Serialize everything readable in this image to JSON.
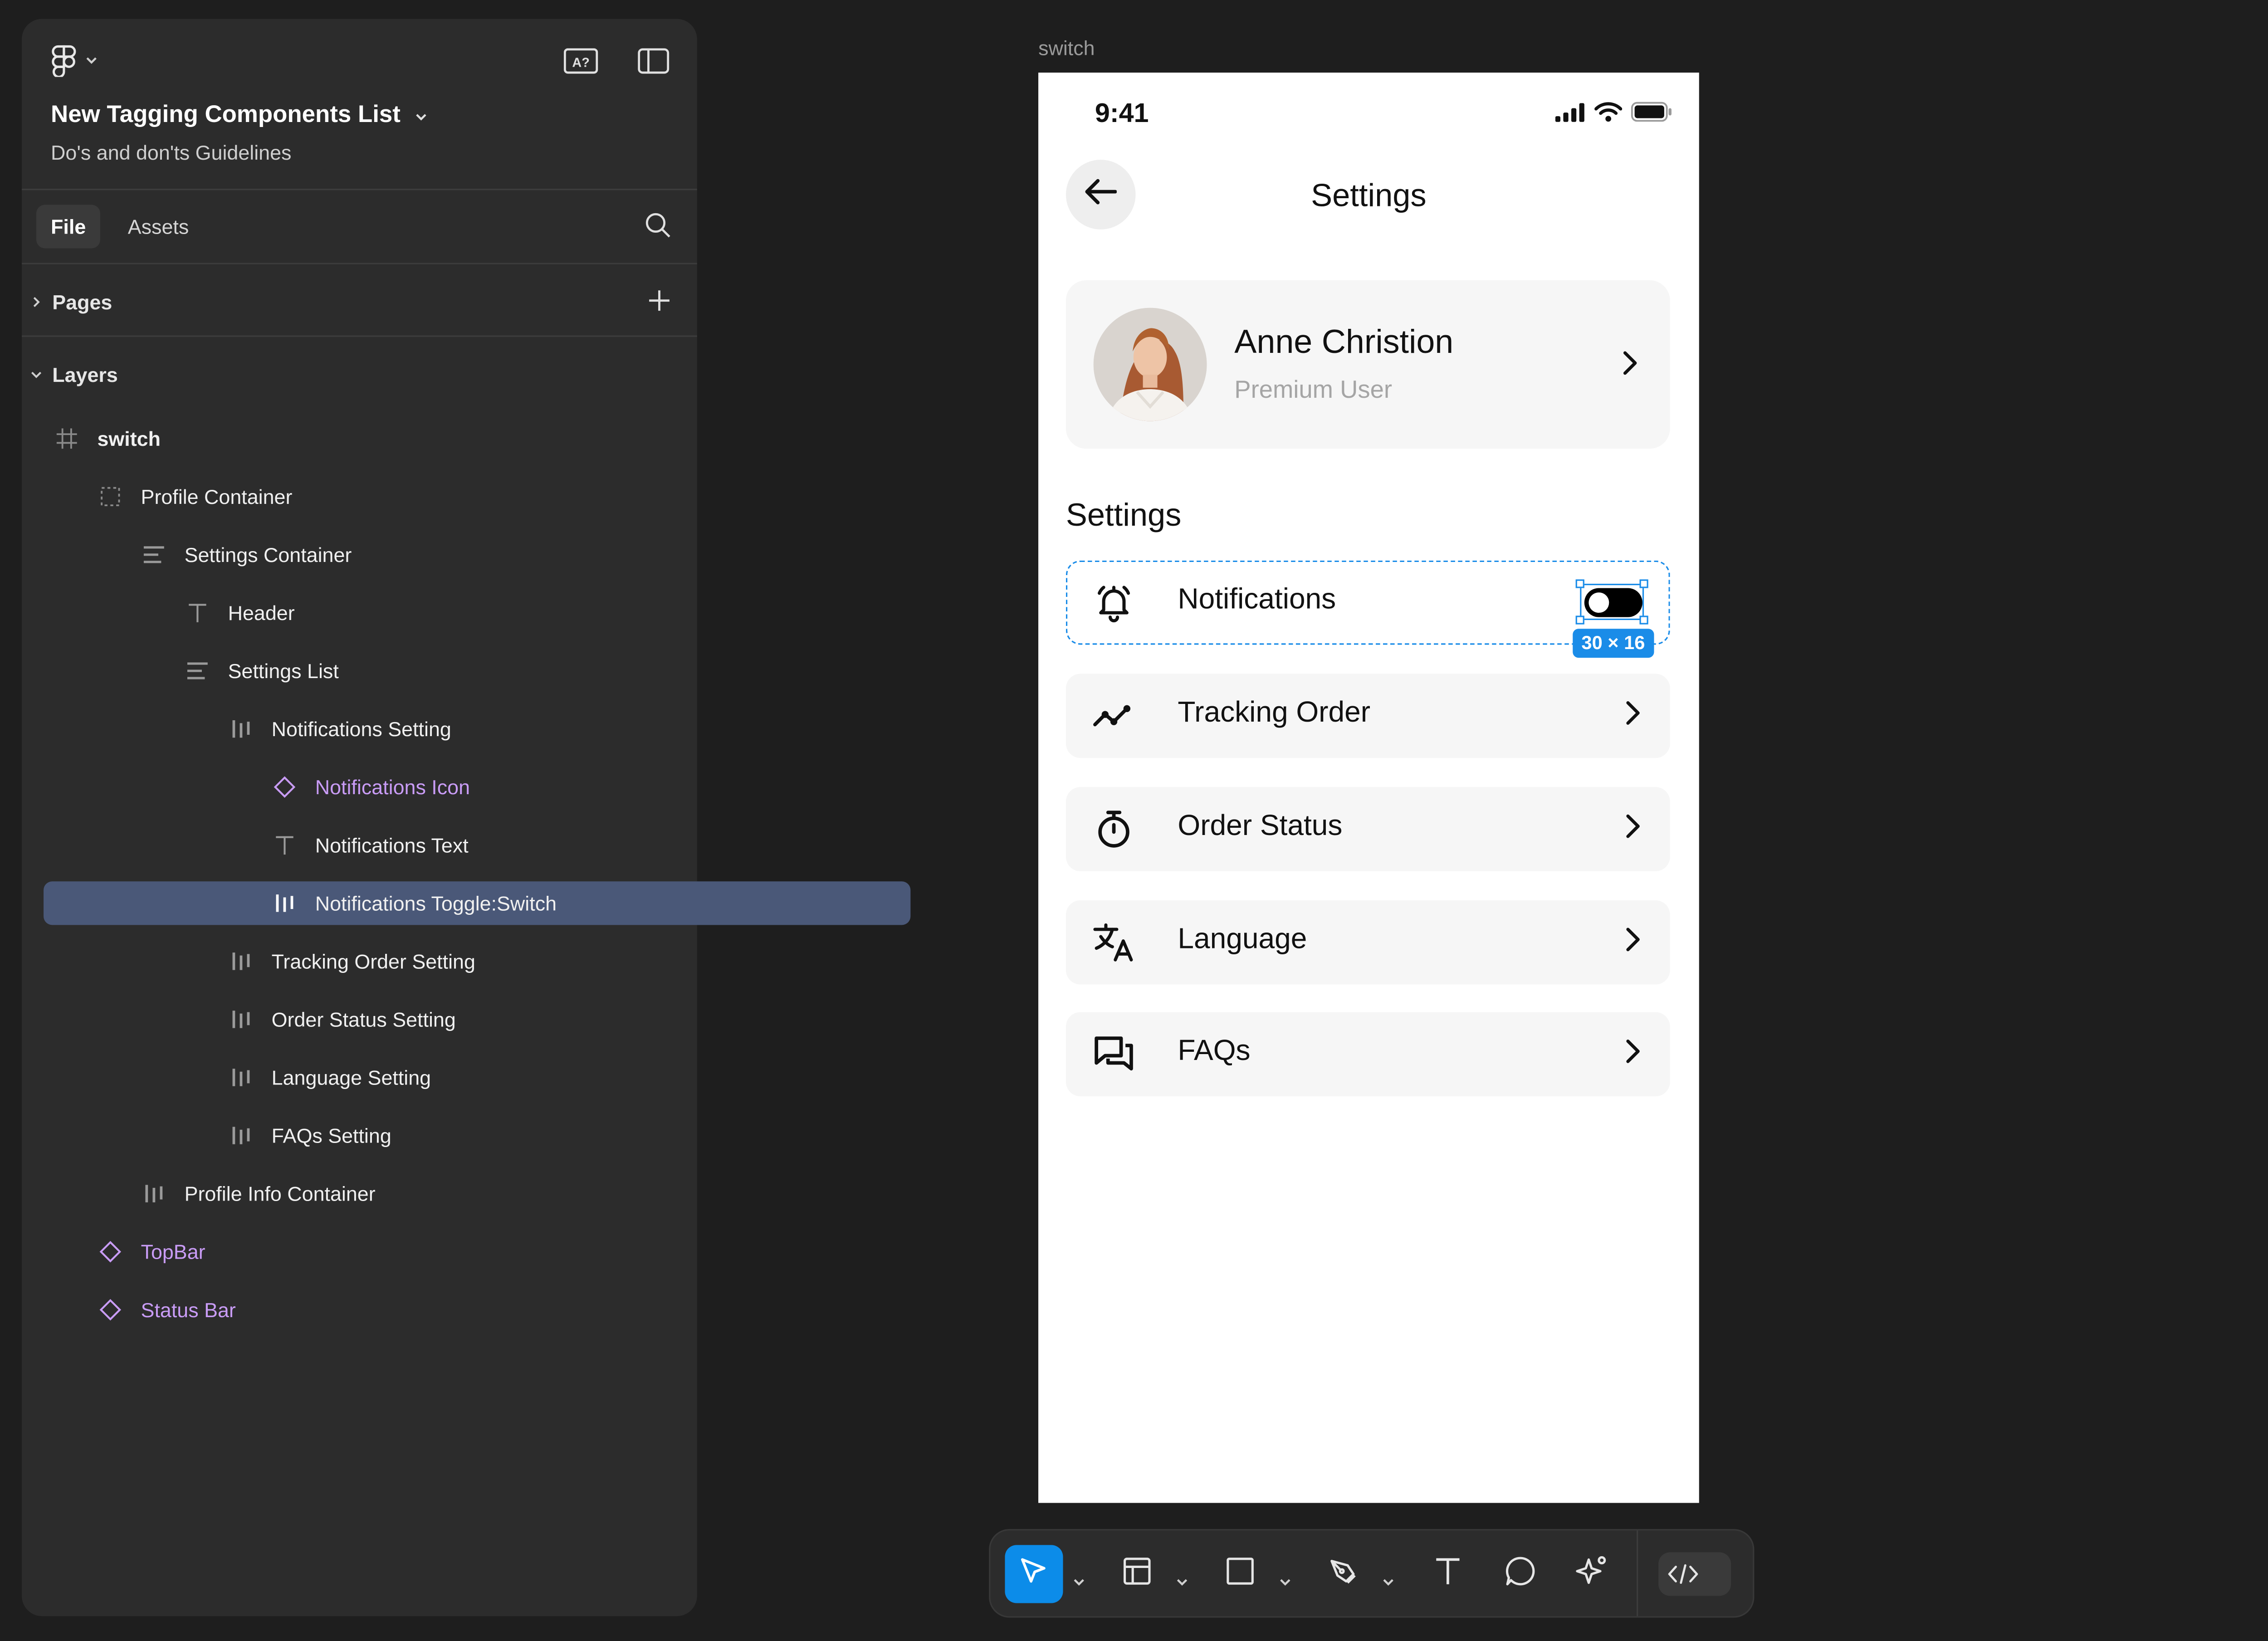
{
  "app": {
    "project_title": "New Tagging Components List",
    "project_subtitle": "Do's and don'ts Guidelines",
    "tabs": {
      "file": "File",
      "assets": "Assets"
    },
    "pages_label": "Pages",
    "layers_label": "Layers",
    "layers": [
      {
        "label": "switch",
        "icon": "frame-icon",
        "type": "frame",
        "depth": 0
      },
      {
        "label": "Profile Container",
        "icon": "dashed-frame-icon",
        "type": "frame",
        "depth": 1
      },
      {
        "label": "Settings Container",
        "icon": "vertical-stack-icon",
        "type": "frame",
        "depth": 2
      },
      {
        "label": "Header",
        "icon": "text-icon",
        "type": "text",
        "depth": 3
      },
      {
        "label": "Settings List",
        "icon": "vertical-stack-icon",
        "type": "frame",
        "depth": 3
      },
      {
        "label": "Notifications Setting",
        "icon": "horizontal-stack-icon",
        "type": "frame",
        "depth": 4
      },
      {
        "label": "Notifications Icon",
        "icon": "component-instance-icon",
        "type": "component",
        "depth": 5
      },
      {
        "label": "Notifications Text",
        "icon": "text-icon",
        "type": "text",
        "depth": 5
      },
      {
        "label": "Notifications Toggle:Switch",
        "icon": "horizontal-stack-icon",
        "type": "frame",
        "depth": 5,
        "selected": true
      },
      {
        "label": "Tracking Order Setting",
        "icon": "horizontal-stack-icon",
        "type": "frame",
        "depth": 4
      },
      {
        "label": "Order Status Setting",
        "icon": "horizontal-stack-icon",
        "type": "frame",
        "depth": 4
      },
      {
        "label": "Language Setting",
        "icon": "horizontal-stack-icon",
        "type": "frame",
        "depth": 4
      },
      {
        "label": "FAQs Setting",
        "icon": "horizontal-stack-icon",
        "type": "frame",
        "depth": 4
      },
      {
        "label": "Profile Info Container",
        "icon": "horizontal-stack-icon",
        "type": "frame",
        "depth": 2
      },
      {
        "label": "TopBar",
        "icon": "component-instance-icon",
        "type": "component",
        "depth": 1
      },
      {
        "label": "Status Bar",
        "icon": "component-instance-icon",
        "type": "component",
        "depth": 1
      }
    ]
  },
  "canvas": {
    "frame_label": "switch",
    "selection_size": "30 × 16"
  },
  "phone": {
    "time": "9:41",
    "title": "Settings",
    "profile": {
      "name": "Anne Christion",
      "role": "Premium User"
    },
    "section_title": "Settings",
    "rows": [
      {
        "label": "Notifications",
        "icon": "bell-icon",
        "control": "toggle",
        "toggle_on": false
      },
      {
        "label": "Tracking Order",
        "icon": "trend-icon",
        "control": "chevron"
      },
      {
        "label": "Order Status",
        "icon": "stopwatch-icon",
        "control": "chevron"
      },
      {
        "label": "Language",
        "icon": "translate-icon",
        "control": "chevron"
      },
      {
        "label": "FAQs",
        "icon": "chat-bubbles-icon",
        "control": "chevron"
      }
    ]
  },
  "colors": {
    "accent": "#0c8ce9",
    "selection": "#1a8ce8",
    "component": "#c99cf6",
    "selected_layer": "#4a5878",
    "app_bg": "#1e1e1e",
    "panel_bg": "#2c2c2c"
  }
}
